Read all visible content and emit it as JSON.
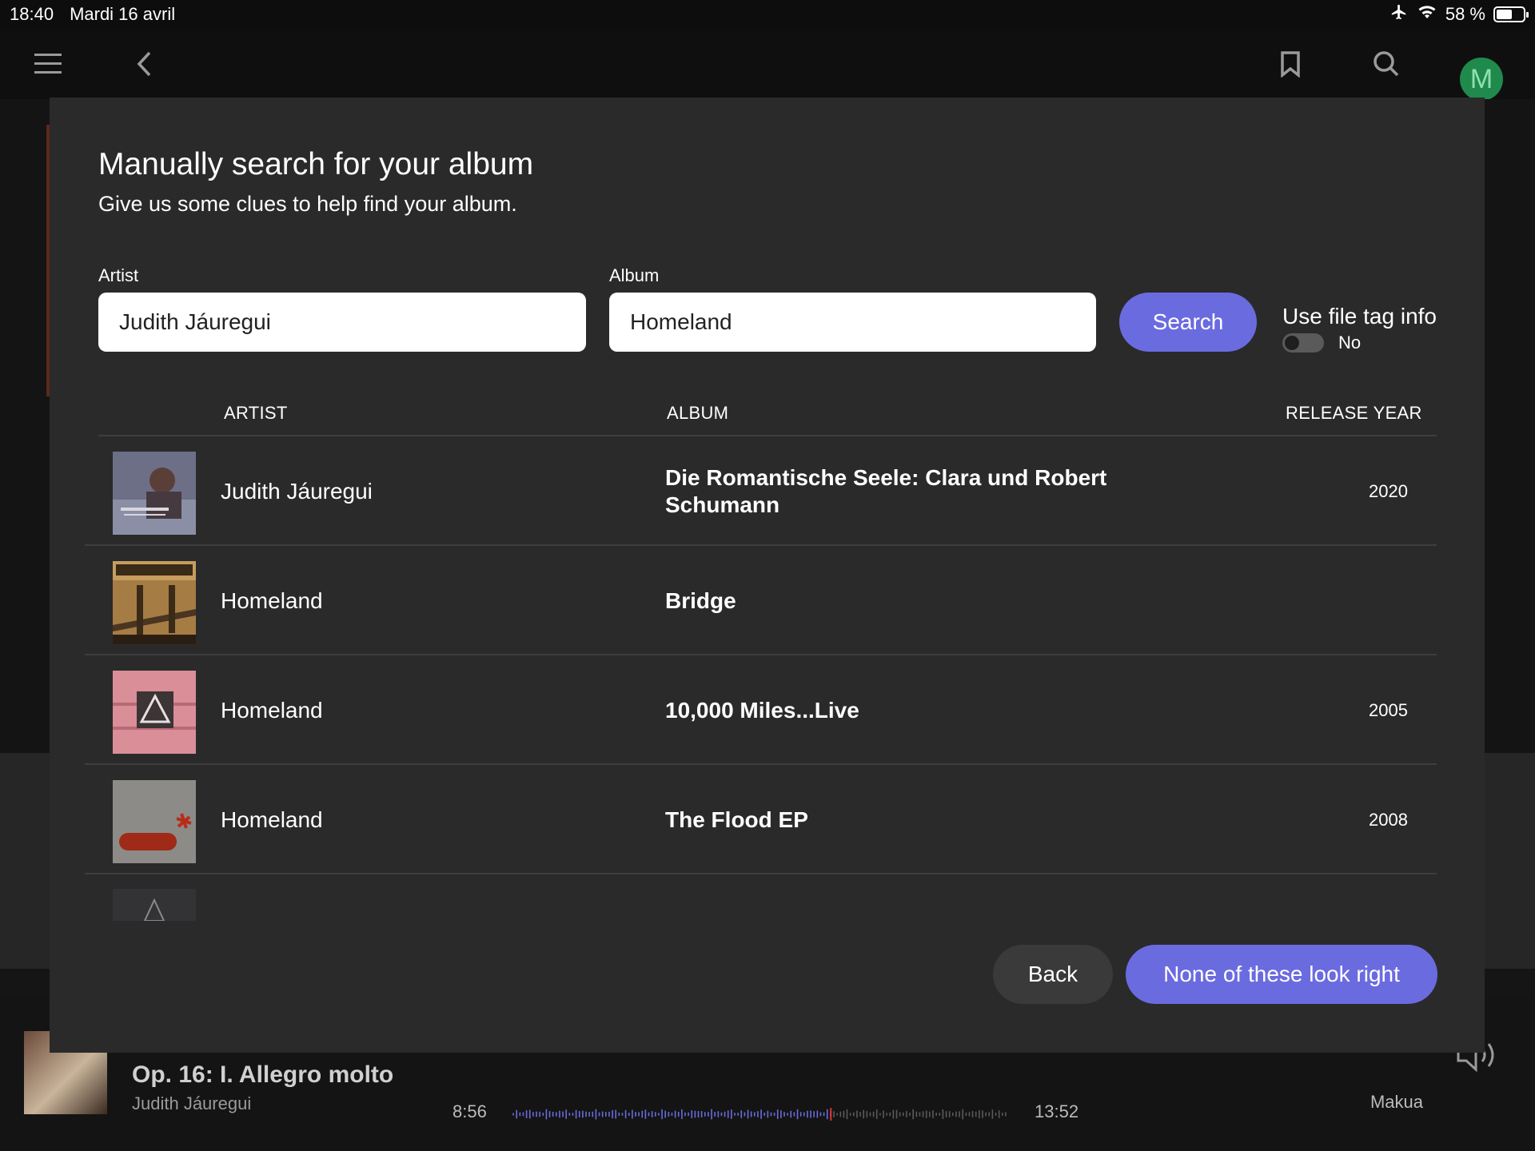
{
  "status_bar": {
    "time": "18:40",
    "date": "Mardi 16 avril",
    "battery": "58 %",
    "battery_level": 0.58
  },
  "player": {
    "track_title": "Op. 16: I. Allegro molto",
    "track_artist": "Judith Jáuregui",
    "elapsed": "8:56",
    "total": "13:52",
    "progress": 0.644,
    "zone": "Makua"
  },
  "modal": {
    "title": "Manually search for your album",
    "subtitle": "Give us some clues to help find your album.",
    "artist_label": "Artist",
    "artist_value": "Judith Jáuregui",
    "album_label": "Album",
    "album_value": "Homeland",
    "search_label": "Search",
    "tag_info_label": "Use file tag info",
    "tag_info_state": "No",
    "columns": {
      "artist": "ARTIST",
      "album": "ALBUM",
      "year": "RELEASE YEAR"
    },
    "results": [
      {
        "artist": "Judith Jáuregui",
        "album": "Die Romantische Seele: Clara und Robert Schumann",
        "year": "2020"
      },
      {
        "artist": "Homeland",
        "album": "Bridge",
        "year": ""
      },
      {
        "artist": "Homeland",
        "album": "10,000 Miles...Live",
        "year": "2005"
      },
      {
        "artist": "Homeland",
        "album": "The Flood EP",
        "year": "2008"
      }
    ],
    "back_label": "Back",
    "none_label": "None of these look right"
  },
  "colors": {
    "accent": "#6b6be0",
    "modal_bg": "#2a2a2b",
    "avatar": "#1f8a4c"
  },
  "user": {
    "avatar_initial": "M"
  }
}
